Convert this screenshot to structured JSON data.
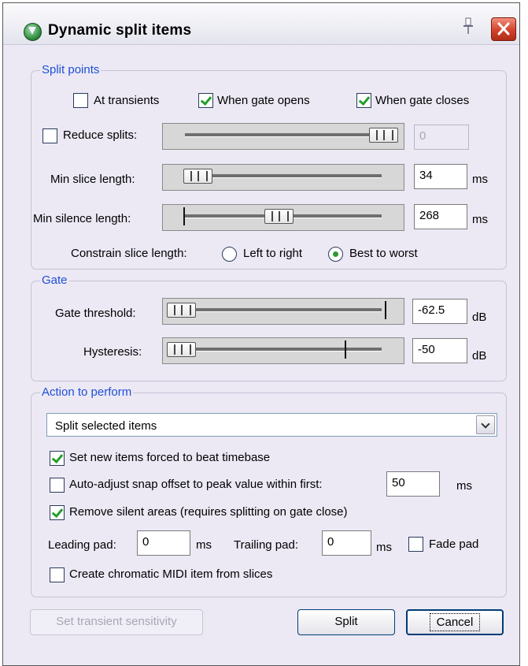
{
  "window": {
    "title": "Dynamic split items",
    "icon": "reaper-app-icon",
    "pin_icon": "pin-icon",
    "close_icon": "close-icon"
  },
  "split_points": {
    "legend": "Split points",
    "at_transients": {
      "label": "At transients",
      "checked": false
    },
    "when_gate_opens": {
      "label": "When gate opens",
      "checked": true
    },
    "when_gate_closes": {
      "label": "When gate closes",
      "checked": true
    },
    "reduce_splits": {
      "label": "Reduce splits:",
      "checked": false,
      "value": "0",
      "slider_fraction": 1.0
    },
    "min_slice_length": {
      "label": "Min slice length:",
      "value": "34",
      "unit": "ms",
      "slider_fraction": 0.0
    },
    "min_silence_length": {
      "label": "Min silence length:",
      "value": "268",
      "unit": "ms",
      "slider_fraction": 0.45
    },
    "constrain": {
      "label": "Constrain slice length:",
      "options": [
        "Left to right",
        "Best to worst"
      ],
      "selected": "Best to worst"
    }
  },
  "gate": {
    "legend": "Gate",
    "threshold": {
      "label": "Gate threshold:",
      "value": "-62.5",
      "unit": "dB",
      "slider_fraction": 0.0
    },
    "hysteresis": {
      "label": "Hysteresis:",
      "value": "-50",
      "unit": "dB",
      "slider_fraction": 0.0
    }
  },
  "action": {
    "legend": "Action to perform",
    "selected_action": "Split selected items",
    "set_forced_beat": {
      "label": "Set new items forced to beat timebase",
      "checked": true
    },
    "auto_adjust": {
      "label": "Auto-adjust snap offset to peak value within first:",
      "checked": false,
      "value": "50",
      "unit": "ms"
    },
    "remove_silent": {
      "label": "Remove silent areas (requires splitting on gate close)",
      "checked": true
    },
    "leading_pad": {
      "label": "Leading pad:",
      "value": "0",
      "unit": "ms"
    },
    "trailing_pad": {
      "label": "Trailing pad:",
      "value": "0",
      "unit": "ms"
    },
    "fade_pad": {
      "label": "Fade pad",
      "checked": false
    },
    "create_midi": {
      "label": "Create chromatic MIDI item from slices",
      "checked": false
    }
  },
  "buttons": {
    "transient_sensitivity": "Set transient sensitivity",
    "split": "Split",
    "cancel": "Cancel"
  }
}
